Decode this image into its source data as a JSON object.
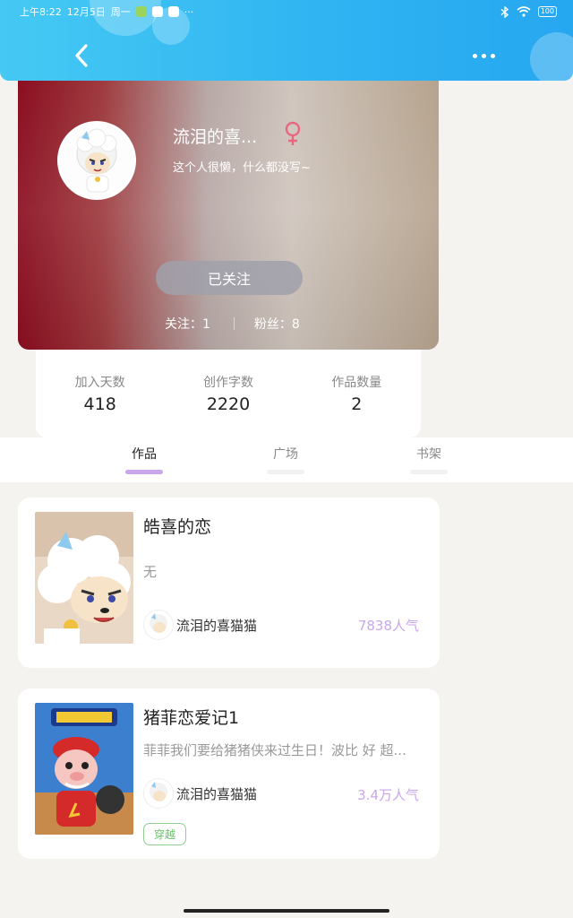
{
  "status_bar": {
    "time": "上午8:22",
    "date": "12月5日",
    "weekday": "周一",
    "dots": "···",
    "battery": "100"
  },
  "topbar": {
    "back_icon": "chevron-left-icon",
    "more_icon": "more-dots-icon",
    "accent": "#2fb3f2"
  },
  "profile": {
    "nickname": "流泪的喜...",
    "gender_icon": "female-symbol-icon",
    "gender_color": "#e8677f",
    "bio": "这个人很懒，什么都没写~",
    "follow_button": "已关注",
    "following": "关注：1",
    "followers": "粉丝：8"
  },
  "stats": [
    {
      "label": "加入天数",
      "value": "418"
    },
    {
      "label": "创作字数",
      "value": "2220"
    },
    {
      "label": "作品数量",
      "value": "2"
    }
  ],
  "tabs": [
    {
      "label": "作品",
      "active": true
    },
    {
      "label": "广场",
      "active": false
    },
    {
      "label": "书架",
      "active": false
    }
  ],
  "works": [
    {
      "title": "皓喜的恋",
      "description": "无",
      "author": "流泪的喜猫猫",
      "popularity": "7838人气",
      "tag": ""
    },
    {
      "title": "猪菲恋爱记1",
      "description": "菲菲我们要给猪猪侠来过生日！波比 好 超...",
      "author": "流泪的喜猫猫",
      "popularity": "3.4万人气",
      "tag": "穿越"
    }
  ]
}
